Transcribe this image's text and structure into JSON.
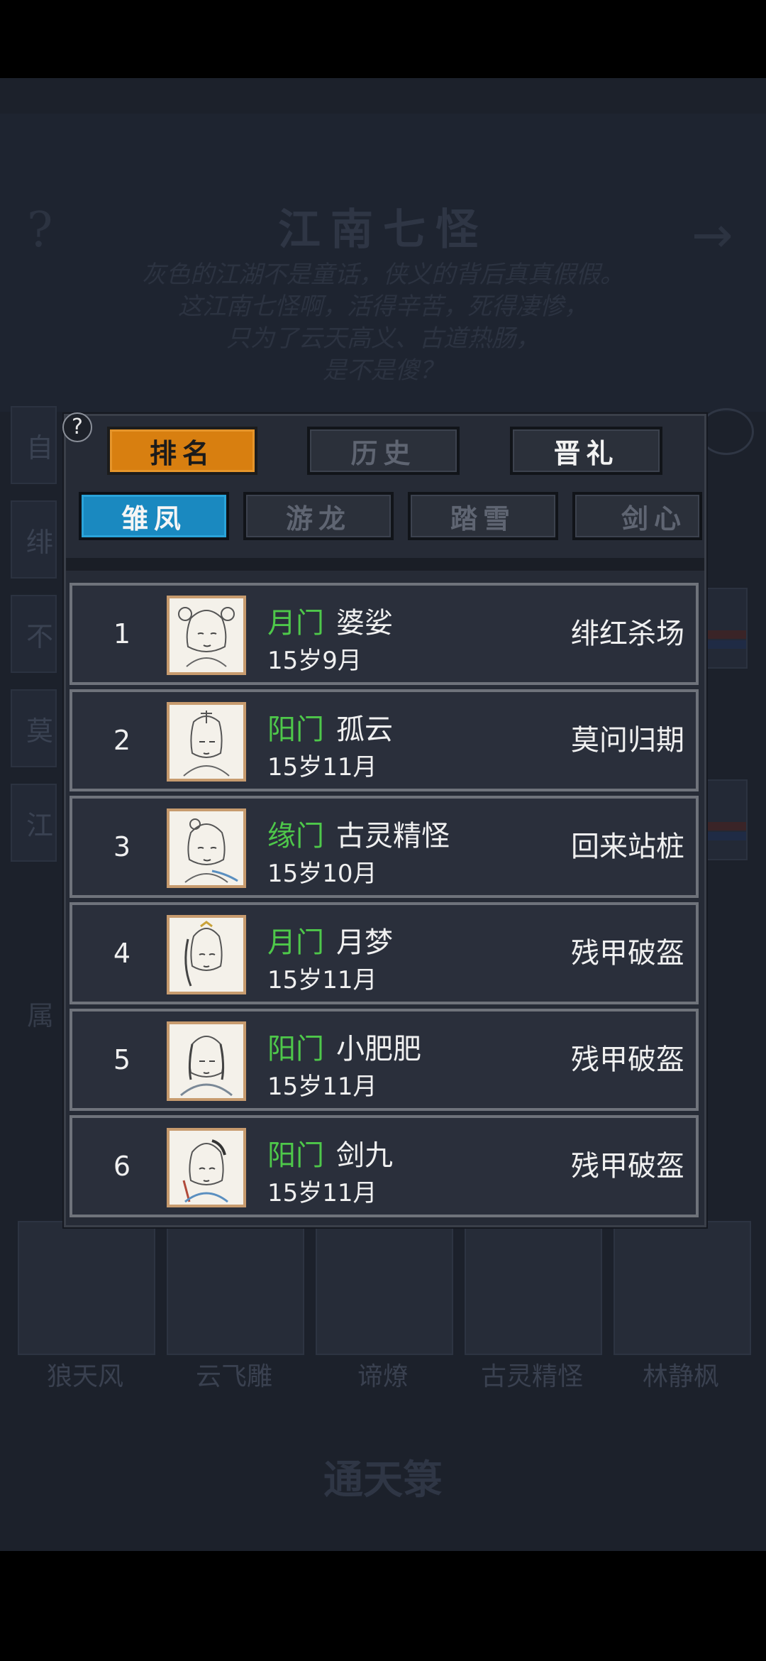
{
  "background": {
    "title": "江南七怪",
    "description": [
      "灰色的江湖不是童话，侠义的背后真真假假。",
      "这江南七怪啊，活得辛苦，死得凄惨，",
      "只为了云天高义、古道热肠，",
      "是不是傻？"
    ],
    "side_labels": [
      "自",
      "绯",
      "不",
      "莫",
      "江"
    ],
    "attr_label": "属",
    "portrait_names": [
      "狼天风",
      "云飞雕",
      "谛燎",
      "古灵精怪",
      "林静枫"
    ],
    "bottom_title": "通天箓"
  },
  "modal": {
    "main_tabs": [
      "排名",
      "历史",
      "晋礼"
    ],
    "sub_tabs": [
      "雏凤",
      "游龙",
      "踏雪",
      "剑心"
    ],
    "rows": [
      {
        "rank": "1",
        "sect": "月门",
        "name": "婆娑",
        "age": "15岁9月",
        "place": "绯红杀场"
      },
      {
        "rank": "2",
        "sect": "阳门",
        "name": "孤云",
        "age": "15岁11月",
        "place": "莫问归期"
      },
      {
        "rank": "3",
        "sect": "缘门",
        "name": "古灵精怪",
        "age": "15岁10月",
        "place": "回来站桩"
      },
      {
        "rank": "4",
        "sect": "月门",
        "name": "月梦",
        "age": "15岁11月",
        "place": "残甲破盔"
      },
      {
        "rank": "5",
        "sect": "阳门",
        "name": "小肥肥",
        "age": "15岁11月",
        "place": "残甲破盔"
      },
      {
        "rank": "6",
        "sect": "阳门",
        "name": "剑九",
        "age": "15岁11月",
        "place": "残甲破盔"
      }
    ]
  },
  "colors": {
    "accent_orange": "#d87f10",
    "accent_blue": "#1a89c0",
    "sect_green": "#4ec84a"
  }
}
